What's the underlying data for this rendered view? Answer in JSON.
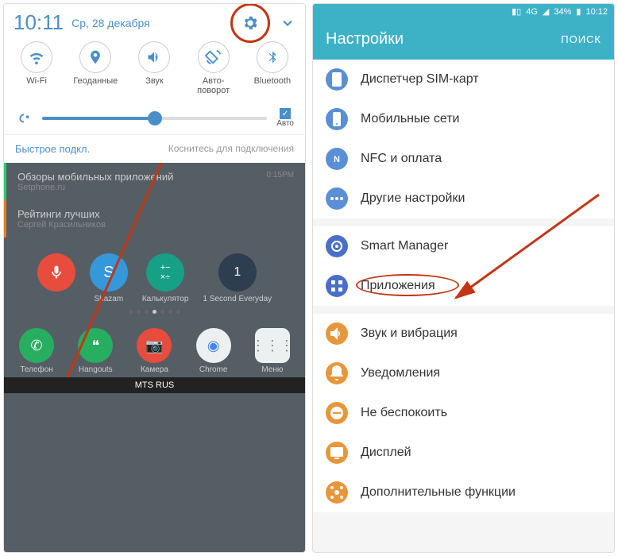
{
  "left": {
    "time": "10:11",
    "date": "Ср, 28 декабря",
    "toggles": [
      {
        "label": "Wi-Fi",
        "icon": "wifi"
      },
      {
        "label": "Геоданные",
        "icon": "location"
      },
      {
        "label": "Звук",
        "icon": "sound"
      },
      {
        "label": "Авто-поворот",
        "icon": "rotate"
      },
      {
        "label": "Bluetooth",
        "icon": "bluetooth"
      }
    ],
    "auto_label": "Авто",
    "quick_connect": {
      "left": "Быстрое подкл.",
      "right": "Коснитесь для подключения"
    },
    "notifications": [
      {
        "title": "Обзоры мобильных приложений",
        "sub": "Setphone.ru",
        "time": "0:15PM"
      },
      {
        "title": "Рейтинги лучших",
        "sub": "Сергей Красильников"
      }
    ],
    "apps": [
      {
        "label": "",
        "color": "#e74c3c"
      },
      {
        "label": "Shazam",
        "color": "#3498db"
      },
      {
        "label": "Калькулятор",
        "color": "#16a085"
      },
      {
        "label": "1 Second Everyday",
        "color": "#2c3e50"
      }
    ],
    "dock": [
      {
        "label": "Телефон",
        "color": "#27ae60"
      },
      {
        "label": "Hangouts",
        "color": "#27ae60"
      },
      {
        "label": "Камера",
        "color": "#e74c3c"
      },
      {
        "label": "Chrome",
        "color": "#ecf0f1"
      },
      {
        "label": "Меню",
        "color": "#ecf0f1"
      }
    ],
    "carrier": "MTS RUS"
  },
  "right": {
    "status": {
      "signal": "4G",
      "battery": "34%",
      "time": "10:12"
    },
    "header": {
      "title": "Настройки",
      "search": "ПОИСК"
    },
    "groups": [
      [
        {
          "label": "Диспетчер SIM-карт",
          "color": "#5a8fd6",
          "icon": "sim"
        },
        {
          "label": "Мобильные сети",
          "color": "#5a8fd6",
          "icon": "mobile"
        },
        {
          "label": "NFC и оплата",
          "color": "#5a8fd6",
          "icon": "nfc"
        },
        {
          "label": "Другие настройки",
          "color": "#5a8fd6",
          "icon": "more"
        }
      ],
      [
        {
          "label": "Smart Manager",
          "color": "#4a6fc7",
          "icon": "smart"
        },
        {
          "label": "Приложения",
          "color": "#4a6fc7",
          "icon": "apps",
          "highlighted": true
        }
      ],
      [
        {
          "label": "Звук и вибрация",
          "color": "#e8963a",
          "icon": "sound"
        },
        {
          "label": "Уведомления",
          "color": "#e8963a",
          "icon": "notif"
        },
        {
          "label": "Не беспокоить",
          "color": "#e8963a",
          "icon": "dnd"
        },
        {
          "label": "Дисплей",
          "color": "#e8963a",
          "icon": "display"
        },
        {
          "label": "Дополнительные функции",
          "color": "#e8963a",
          "icon": "advanced"
        }
      ]
    ]
  }
}
